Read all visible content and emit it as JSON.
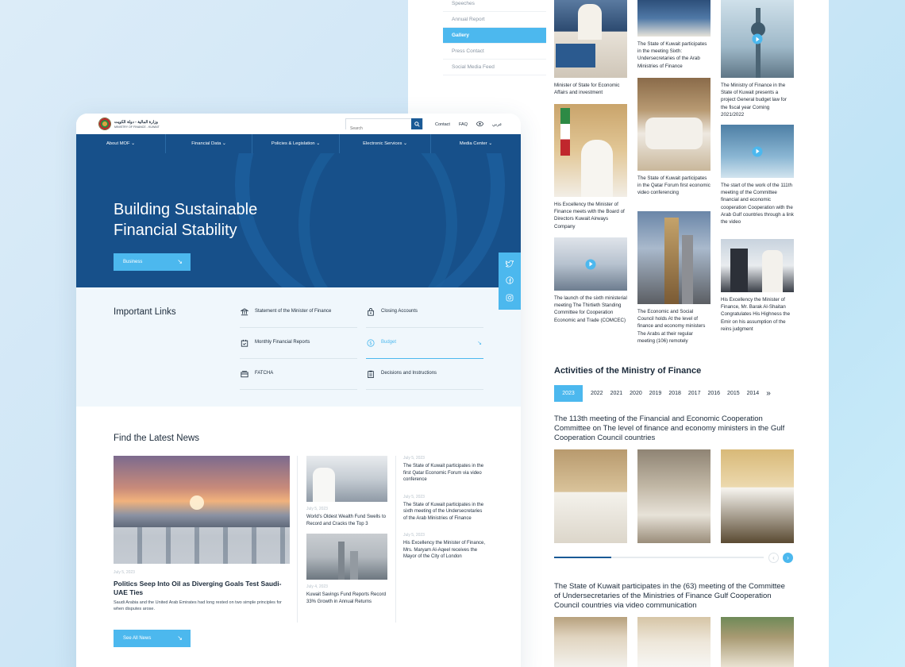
{
  "right_panel": {
    "side_menu": [
      {
        "label": "Speeches",
        "active": false
      },
      {
        "label": "Annual Report",
        "active": false
      },
      {
        "label": "Gallery",
        "active": true
      },
      {
        "label": "Press Contact",
        "active": false
      },
      {
        "label": "Social Media Feed",
        "active": false
      }
    ],
    "gallery": {
      "col1": [
        {
          "caption": "Minister of State for Economic Affairs and investment",
          "video": false
        },
        {
          "caption": "His Excellency the Minister of Finance meets with the Board of Directors Kuwait Airways Company",
          "video": false
        },
        {
          "caption": "The launch of the sixth ministerial meeting The Thirtieth Standing Committee for Cooperation Economic and Trade (COMCEC)",
          "video": true
        }
      ],
      "col2": [
        {
          "caption": "The State of Kuwait participates in the meeting Sixth: Undersecretaries of the Arab Ministries of Finance",
          "video": false
        },
        {
          "caption": "The State of Kuwait participates in the Qatar Forum first economic video conferencing",
          "video": false
        },
        {
          "caption": "The Economic and Social Council holds At the level of finance and economy ministers The Arabs at their regular meeting (106) remotely",
          "video": false
        }
      ],
      "col3": [
        {
          "caption": "The Ministry of Finance in the State of Kuwait presents a project General budget law for the fiscal year Coming 2021/2022",
          "video": true
        },
        {
          "caption": "The start of the work of the 111th meeting of the Committee financial and economic cooperation Cooperation with the Arab Gulf countries through a link the video",
          "video": true
        },
        {
          "caption": "His Excellency the Minister of Finance, Mr. Barak Al-Shaitan Congratulates His Highness the Emir on his assumption of the reins judgment",
          "video": false
        }
      ]
    },
    "activities": {
      "title": "Activities of the Ministry of Finance",
      "years": [
        "2023",
        "2022",
        "2021",
        "2020",
        "2019",
        "2018",
        "2017",
        "2016",
        "2015",
        "2014"
      ],
      "active_year": "2023",
      "more_icon": "double-chevron-right-icon",
      "item1_title": "The 113th meeting of the Financial and Economic Cooperation Committee on The level of finance and economy ministers in the Gulf Cooperation Council countries",
      "item2_title": "The State of Kuwait participates in the (63) meeting of the Committee of Undersecretaries of the Ministries of Finance Gulf Cooperation Council countries via video communication"
    }
  },
  "left_panel": {
    "logo": {
      "line1": "وزارة المالية - دولة الكويت",
      "line2": "MINISTRY OF FINANCE - KUWAIT"
    },
    "search": {
      "placeholder": "Search"
    },
    "top_links": {
      "contact": "Contact",
      "faq": "FAQ",
      "language": "عربي"
    },
    "nav": [
      "About MOF ⌄",
      "Financial Data ⌄",
      "Policies & Legislation ⌄",
      "Electronic Services ⌄",
      "Media Center ⌄"
    ],
    "hero": {
      "title": "Building Sustainable Financial Stability",
      "button": "Business",
      "button_icon": "arrow-down-right-icon"
    },
    "important_links": {
      "title": "Important Links",
      "items": [
        {
          "label": "Statement of the Minister of Finance",
          "icon": "bank-icon"
        },
        {
          "label": "Closing Accounts",
          "icon": "lock-bag-icon"
        },
        {
          "label": "Monthly Financial Reports",
          "icon": "calendar-check-icon"
        },
        {
          "label": "Budget",
          "icon": "dollar-circle-icon",
          "active": true
        },
        {
          "label": "FATCHA",
          "icon": "cards-icon"
        },
        {
          "label": "Decisions and Instructions",
          "icon": "clipboard-icon"
        }
      ]
    },
    "news": {
      "title": "Find the Latest News",
      "featured": {
        "date": "July 5, 2023",
        "title": "Politics Seep Into Oil as Diverging Goals Test Saudi-UAE Ties",
        "desc": "Saudi Arabia and the United Arab Emirates had long rested on two simple principles for when disputes arose."
      },
      "middle": [
        {
          "date": "July 5, 2023",
          "title": "World's Oldest Wealth Fund Swells to Record and Cracks the Top 3"
        },
        {
          "date": "July 4, 2023",
          "title": "Kuwait Savings Fund Reports Record 33% Growth in Annual Returns"
        }
      ],
      "right": [
        {
          "date": "July 5, 2023",
          "title": "The State of Kuwait participates in the first Qatar Economic Forum via video conference"
        },
        {
          "date": "July 5, 2023",
          "title": "The State of Kuwait participates in the sixth meeting of the Undersecretaries of the Arab Ministries of Finance"
        },
        {
          "date": "July 5, 2023",
          "title": "His Excellency the Minister of Finance, Mrs. Maryam Al-Aqeel receives the Mayor of the City of London"
        }
      ],
      "see_all": "See All News"
    },
    "social": [
      "twitter-icon",
      "facebook-icon",
      "instagram-icon"
    ]
  },
  "colors": {
    "navy": "#17508a",
    "accent": "#4cb8ee",
    "light_bg": "#f0f7fc"
  }
}
